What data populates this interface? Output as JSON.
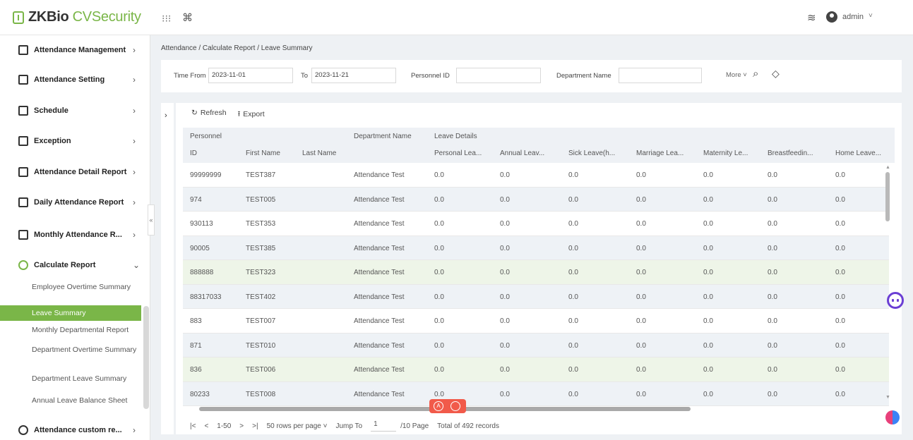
{
  "header": {
    "logo_brand": "ZKBio",
    "logo_product": " CVSecurity",
    "user_name": "admin"
  },
  "sidebar": {
    "items": [
      {
        "label": "Attendance Management",
        "arrow": "›"
      },
      {
        "label": "Attendance Setting",
        "arrow": "›"
      },
      {
        "label": "Schedule",
        "arrow": "›"
      },
      {
        "label": "Exception",
        "arrow": "›"
      },
      {
        "label": "Attendance Detail Report",
        "arrow": "›"
      },
      {
        "label": "Daily Attendance Report",
        "arrow": "›"
      },
      {
        "label": "Monthly Attendance R...",
        "arrow": "›"
      },
      {
        "label": "Calculate Report",
        "arrow": "⌄"
      },
      {
        "label": "Attendance custom re...",
        "arrow": "›"
      }
    ],
    "sub_items": [
      {
        "label": "Employee Overtime Summary"
      },
      {
        "label": "Leave Summary"
      },
      {
        "label": "Monthly Departmental Report"
      },
      {
        "label": "Department Overtime Summary"
      },
      {
        "label": "Department Leave Summary"
      },
      {
        "label": "Annual Leave Balance Sheet"
      }
    ]
  },
  "breadcrumb": "Attendance / Calculate Report / Leave Summary",
  "filters": {
    "time_from_label": "Time From",
    "time_from_value": "2023-11-01",
    "to_label": "To",
    "to_value": "2023-11-21",
    "personnel_id_label": "Personnel ID",
    "personnel_id_value": "",
    "department_label": "Department Name",
    "department_value": "",
    "more_label": "More ˅"
  },
  "toolbar": {
    "refresh_label": "Refresh",
    "export_label": "Export"
  },
  "table": {
    "group_headers": {
      "personnel": "Personnel",
      "department": "Department Name",
      "leave": "Leave Details"
    },
    "columns": [
      "ID",
      "First Name",
      "Last Name",
      "Personal Lea...",
      "Annual Leav...",
      "Sick Leave(h...",
      "Marriage Lea...",
      "Maternity Le...",
      "Breastfeedin...",
      "Home Leave..."
    ],
    "rows": [
      {
        "id": "99999999",
        "first": "TEST387",
        "last": "",
        "dept": "Attendance Test",
        "vals": [
          "0.0",
          "0.0",
          "0.0",
          "0.0",
          "0.0",
          "0.0",
          "0.0"
        ]
      },
      {
        "id": "974",
        "first": "TEST005",
        "last": "",
        "dept": "Attendance Test",
        "vals": [
          "0.0",
          "0.0",
          "0.0",
          "0.0",
          "0.0",
          "0.0",
          "0.0"
        ]
      },
      {
        "id": "930113",
        "first": "TEST353",
        "last": "",
        "dept": "Attendance Test",
        "vals": [
          "0.0",
          "0.0",
          "0.0",
          "0.0",
          "0.0",
          "0.0",
          "0.0"
        ]
      },
      {
        "id": "90005",
        "first": "TEST385",
        "last": "",
        "dept": "Attendance Test",
        "vals": [
          "0.0",
          "0.0",
          "0.0",
          "0.0",
          "0.0",
          "0.0",
          "0.0"
        ]
      },
      {
        "id": "888888",
        "first": "TEST323",
        "last": "",
        "dept": "Attendance Test",
        "vals": [
          "0.0",
          "0.0",
          "0.0",
          "0.0",
          "0.0",
          "0.0",
          "0.0"
        ]
      },
      {
        "id": "88317033",
        "first": "TEST402",
        "last": "",
        "dept": "Attendance Test",
        "vals": [
          "0.0",
          "0.0",
          "0.0",
          "0.0",
          "0.0",
          "0.0",
          "0.0"
        ]
      },
      {
        "id": "883",
        "first": "TEST007",
        "last": "",
        "dept": "Attendance Test",
        "vals": [
          "0.0",
          "0.0",
          "0.0",
          "0.0",
          "0.0",
          "0.0",
          "0.0"
        ]
      },
      {
        "id": "871",
        "first": "TEST010",
        "last": "",
        "dept": "Attendance Test",
        "vals": [
          "0.0",
          "0.0",
          "0.0",
          "0.0",
          "0.0",
          "0.0",
          "0.0"
        ]
      },
      {
        "id": "836",
        "first": "TEST006",
        "last": "",
        "dept": "Attendance Test",
        "vals": [
          "0.0",
          "0.0",
          "0.0",
          "0.0",
          "0.0",
          "0.0",
          "0.0"
        ]
      },
      {
        "id": "80233",
        "first": "TEST008",
        "last": "",
        "dept": "Attendance Test",
        "vals": [
          "0.0",
          "0.0",
          "0.0",
          "0.0",
          "0.0",
          "0.0",
          "0.0"
        ]
      }
    ]
  },
  "pager": {
    "first": "|<",
    "prev": "<",
    "range": "1-50",
    "next": ">",
    "last": ">|",
    "rows_per_page": "50 rows per page ˅",
    "jump_label": "Jump To",
    "jump_value": "1",
    "pages": "/10 Page",
    "total": "Total of 492 records"
  },
  "colors": {
    "accent": "#7ab648",
    "floating_tool": "#f15a4a"
  }
}
